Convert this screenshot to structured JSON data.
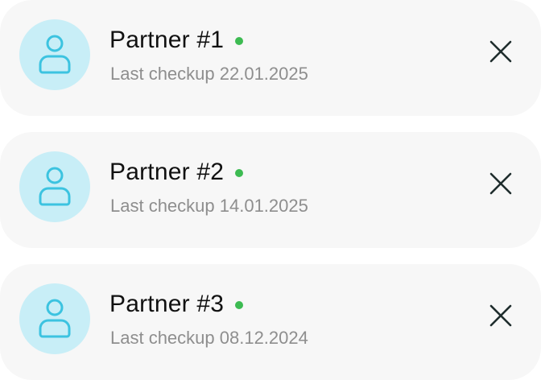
{
  "partners": [
    {
      "name": "Partner #1",
      "checkup": "Last checkup 22.01.2025",
      "status": "online"
    },
    {
      "name": "Partner #2",
      "checkup": "Last checkup 14.01.2025",
      "status": "online"
    },
    {
      "name": "Partner #3",
      "checkup": "Last checkup 08.12.2024",
      "status": "online"
    }
  ],
  "colors": {
    "card_background": "#f7f7f7",
    "avatar_background": "#c8eef7",
    "avatar_icon": "#3cc3e0",
    "status_online": "#3dbb52",
    "name_text": "#111111",
    "secondary_text": "#8e8e8e",
    "close_icon": "#1f2d2d"
  },
  "icons": {
    "avatar": "user-icon",
    "status": "status-dot",
    "remove": "close-icon"
  }
}
